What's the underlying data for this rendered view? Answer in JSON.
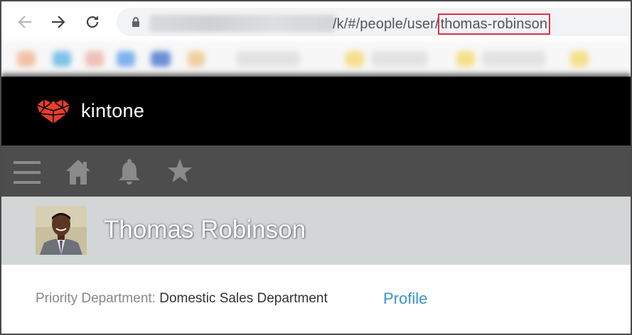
{
  "browser": {
    "url_visible": "/k/#/people/user/",
    "url_highlight": "thomas-robinson",
    "highlight_color": "#e0314b"
  },
  "app": {
    "name": "kintone",
    "brand_color": "#e53e2c"
  },
  "toolbar": {
    "icons": [
      "menu-icon",
      "home-icon",
      "bell-icon",
      "star-icon"
    ]
  },
  "profile": {
    "name": "Thomas Robinson",
    "priority_label": "Priority Department:",
    "priority_value": "Domestic Sales Department",
    "profile_link": "Profile",
    "link_color": "#3e93d0"
  }
}
